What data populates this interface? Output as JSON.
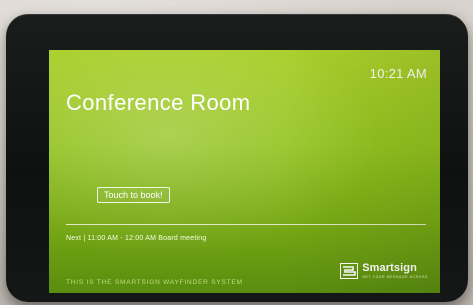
{
  "screen": {
    "time": "10:21 AM",
    "room_name": "Conference Room",
    "book_button_label": "Touch to book!",
    "next_meeting": "Next | 11:00 AM - 12:00 AM Board meeting",
    "footer": "This is the Smartsign Wayfinder System"
  },
  "brand": {
    "name": "Smartsign",
    "tagline": "Get your message across",
    "icon": "smartsign-logo-icon"
  },
  "colors": {
    "screen_top": "#a9cf2a",
    "screen_bottom": "#5a8c10",
    "bezel": "#111313"
  }
}
